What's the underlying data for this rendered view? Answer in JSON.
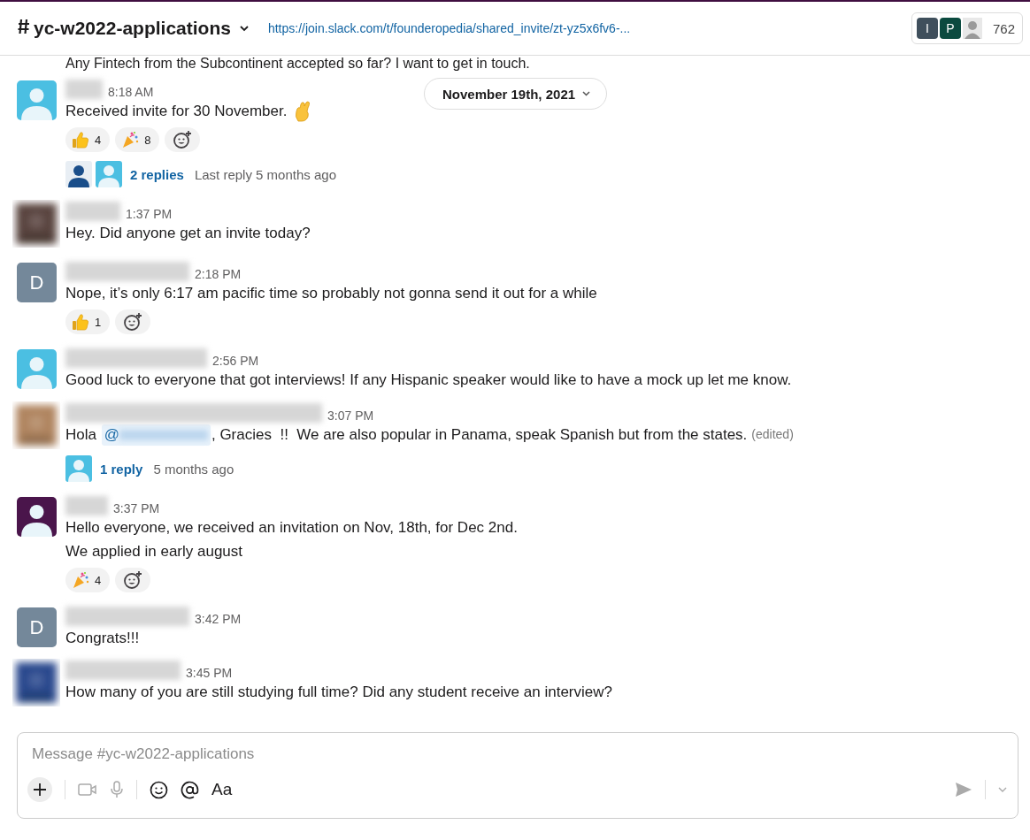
{
  "channel": {
    "name": "yc-w2022-applications",
    "url": "https://join.slack.com/t/founderopedia/shared_invite/zt-yz5x6fv6-...",
    "members": {
      "initials": [
        "I",
        "P"
      ],
      "count": "762"
    }
  },
  "date_divider": "November 19th, 2021",
  "cut_line": "Any Fintech from the Subcontinent accepted so far? I want to get in touch.",
  "messages": [
    {
      "avatar": {
        "kind": "default",
        "color": "#4bbfe2"
      },
      "time": "8:18 AM",
      "lines": [
        [
          {
            "kind": "text",
            "text": "Received invite for 30 November. "
          },
          {
            "kind": "fingers"
          }
        ]
      ],
      "reactions": [
        {
          "kind": "thumbsup",
          "count": "4"
        },
        {
          "kind": "tada",
          "count": "8"
        }
      ],
      "thread": {
        "avatars": [
          {
            "kind": "inverse",
            "color": "#1a4e8a"
          },
          {
            "kind": "default",
            "color": "#4bbfe2"
          }
        ],
        "replies": "2 replies",
        "last": "Last reply 5 months ago"
      }
    },
    {
      "avatar": {
        "kind": "picture",
        "color": "#5a4540"
      },
      "time": "1:37 PM",
      "lines": [
        [
          {
            "kind": "text",
            "text": "Hey. Did anyone get an invite today?"
          }
        ]
      ]
    },
    {
      "avatar": {
        "kind": "letter",
        "letter": "D",
        "color": "#74889a"
      },
      "time": "2:18 PM",
      "lines": [
        [
          {
            "kind": "text",
            "text": "Nope, it’s only 6:17 am pacific time so probably not gonna send it out for a while"
          }
        ]
      ],
      "reactions": [
        {
          "kind": "thumbsup",
          "count": "1"
        }
      ]
    },
    {
      "avatar": {
        "kind": "default",
        "color": "#4bbfe2"
      },
      "time": "2:56 PM",
      "lines": [
        [
          {
            "kind": "text",
            "text": "Good luck to everyone that got interviews! If any Hispanic speaker would like to have a mock up let me know."
          }
        ]
      ]
    },
    {
      "avatar": {
        "kind": "picture",
        "color": "#b08560"
      },
      "time": "3:07 PM",
      "lines": [
        [
          {
            "kind": "text",
            "text": "Hola "
          },
          {
            "kind": "mention",
            "text": "@"
          },
          {
            "kind": "text",
            "text": ", Gracies  !!  We are also popular in Panama, speak Spanish but from the states."
          },
          {
            "kind": "edited",
            "text": "(edited)"
          }
        ]
      ],
      "thread": {
        "avatars": [
          {
            "kind": "default",
            "color": "#4bbfe2"
          }
        ],
        "replies": "1 reply",
        "last": "5 months ago"
      }
    },
    {
      "avatar": {
        "kind": "default",
        "color": "#4a154b"
      },
      "time": "3:37 PM",
      "lines": [
        [
          {
            "kind": "text",
            "text": "Hello everyone, we received an invitation on Nov, 18th, for Dec 2nd."
          }
        ],
        [
          {
            "kind": "text",
            "text": "We applied in early august"
          }
        ]
      ],
      "reactions": [
        {
          "kind": "tada",
          "count": "4"
        }
      ]
    },
    {
      "avatar": {
        "kind": "letter",
        "letter": "D",
        "color": "#74889a"
      },
      "time": "3:42 PM",
      "lines": [
        [
          {
            "kind": "text",
            "text": "Congrats!!!"
          }
        ]
      ]
    },
    {
      "avatar": {
        "kind": "picture",
        "color": "#2a4a8e"
      },
      "time": "3:45 PM",
      "lines": [
        [
          {
            "kind": "text",
            "text": "How many of you are still studying full time? Did any student receive an interview?"
          }
        ]
      ]
    }
  ],
  "composer": {
    "placeholder": "Message #yc-w2022-applications",
    "format_label": "Aa"
  }
}
